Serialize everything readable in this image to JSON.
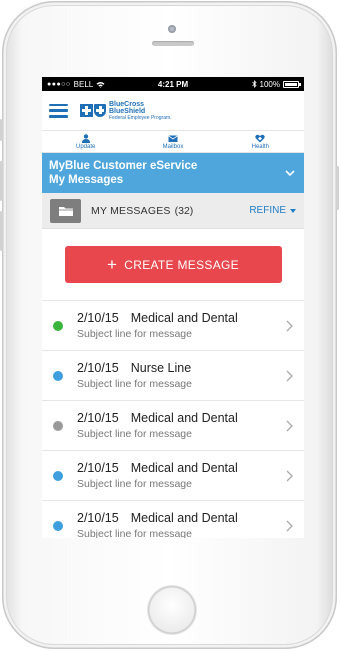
{
  "status_bar": {
    "carrier": "BELL",
    "time": "4:21 PM",
    "battery": "100%"
  },
  "header": {
    "logo_line1": "BlueCross",
    "logo_line2": "BlueShield",
    "logo_line3": "Federal Employee Program."
  },
  "tabs": [
    {
      "label": "Update",
      "icon": "person-icon"
    },
    {
      "label": "Mailbox",
      "icon": "mail-icon"
    },
    {
      "label": "Health",
      "icon": "heart-icon"
    }
  ],
  "banner": {
    "line1": "MyBlue Customer eService",
    "line2": "My Messages"
  },
  "messages_header": {
    "title": "MY MESSAGES",
    "count": "(32)",
    "refine_label": "REFINE"
  },
  "create_button": {
    "label": "CREATE MESSAGE"
  },
  "colors": {
    "accent_blue": "#1f6fb6",
    "banner_blue": "#4ea6dd",
    "create_red": "#e8474d"
  },
  "messages": [
    {
      "date": "2/10/15",
      "title": "Medical and Dental",
      "subject": "Subject line for message",
      "status_color": "#3cb53c"
    },
    {
      "date": "2/10/15",
      "title": "Nurse Line",
      "subject": "Subject line for message",
      "status_color": "#3e9fdc"
    },
    {
      "date": "2/10/15",
      "title": "Medical and Dental",
      "subject": "Subject line for message",
      "status_color": "#9a9a9a"
    },
    {
      "date": "2/10/15",
      "title": "Medical and Dental",
      "subject": "Subject line for message",
      "status_color": "#3e9fdc"
    },
    {
      "date": "2/10/15",
      "title": "Medical and Dental",
      "subject": "Subject line for message",
      "status_color": "#3e9fdc"
    }
  ]
}
